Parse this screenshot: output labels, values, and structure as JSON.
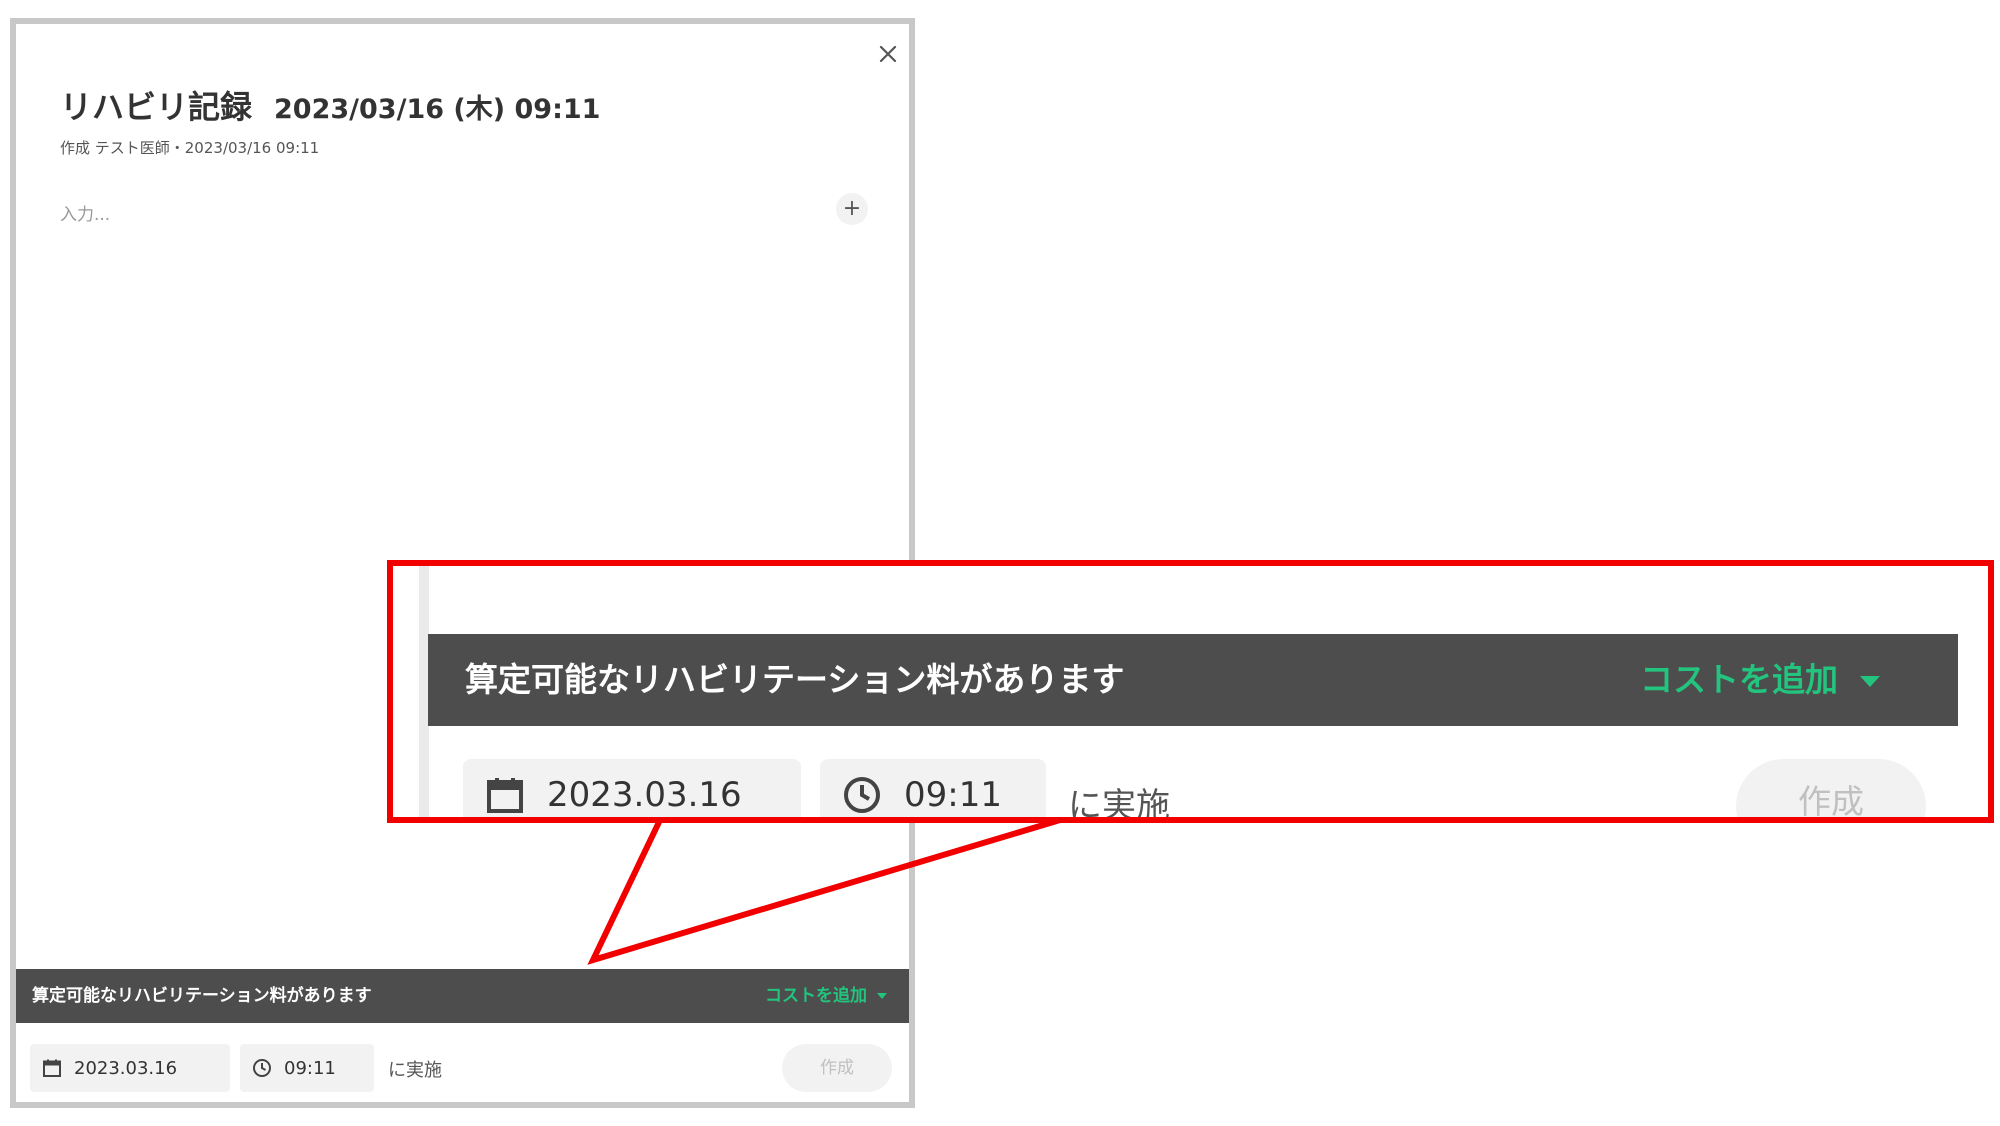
{
  "dialog": {
    "title": "リハビリ記録",
    "datetime": "2023/03/16 (木) 09:11",
    "meta": "作成 テスト医師・2023/03/16 09:11",
    "input_placeholder": "入力...",
    "plus_label": "+",
    "close_icon": "close-icon"
  },
  "banner": {
    "message": "算定可能なリハビリテーション料があります",
    "add_cost_label": "コストを追加"
  },
  "footer": {
    "date": "2023.03.16",
    "time": "09:11",
    "done_label": "に実施",
    "create_label": "作成"
  },
  "colors": {
    "accent_green": "#22c47e",
    "banner_bg": "#4d4d4d",
    "callout_red": "#f20000"
  }
}
